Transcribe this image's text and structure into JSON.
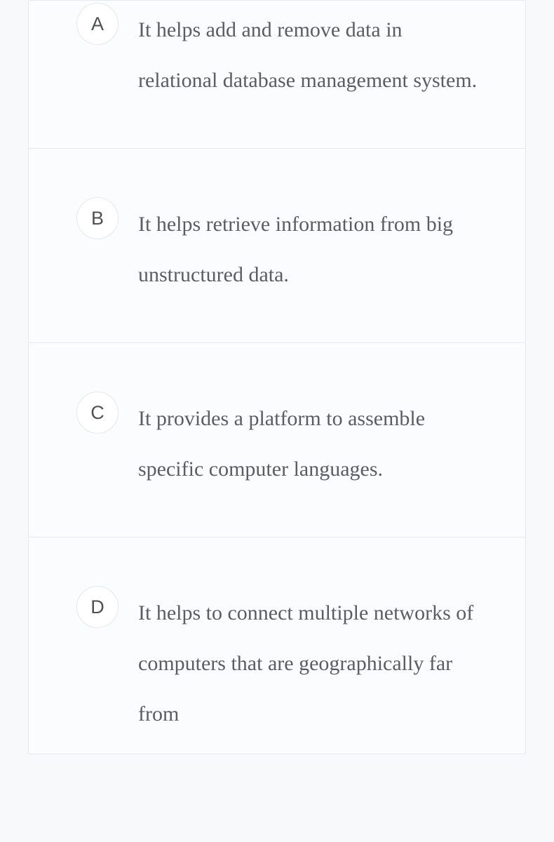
{
  "options": [
    {
      "letter": "A",
      "text": "It helps add and remove data in relational database management system."
    },
    {
      "letter": "B",
      "text": "It helps retrieve information from big unstructured data."
    },
    {
      "letter": "C",
      "text": "It provides a platform to assemble specific computer languages."
    },
    {
      "letter": "D",
      "text": "It helps to connect multiple networks of computers that are geographically far from"
    }
  ]
}
